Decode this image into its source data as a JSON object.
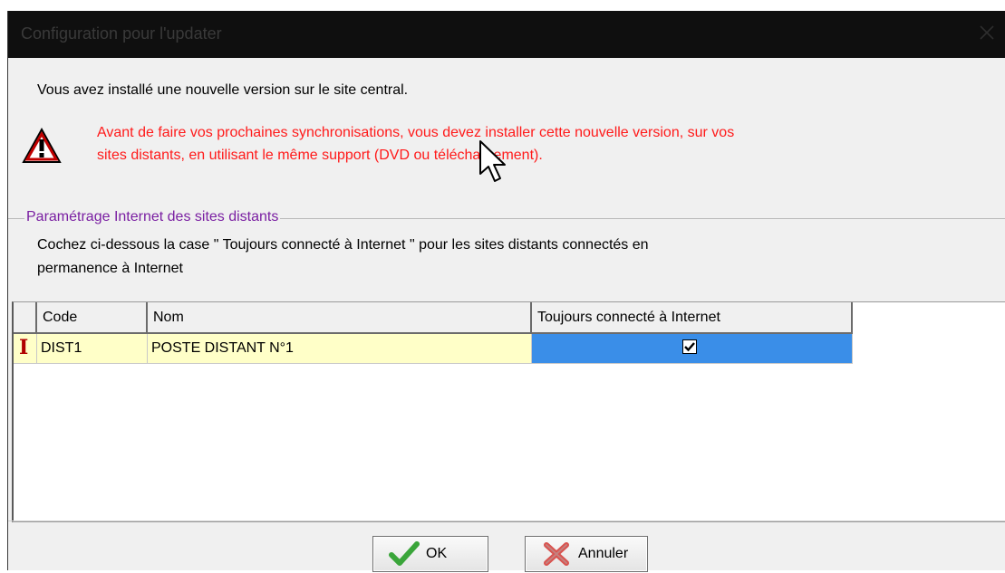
{
  "window": {
    "title": "Configuration pour l'updater",
    "close_icon": "close-icon"
  },
  "intro_text": "Vous avez installé une nouvelle version sur le site central.",
  "warning": {
    "icon": "warning-triangle-icon",
    "color": "#ff1a1a",
    "text_line1": "Avant de faire vos prochaines synchronisations, vous devez installer cette nouvelle version, sur vos",
    "text_line2": "sites distants, en utilisant le même support (DVD ou téléchargement)."
  },
  "group": {
    "title": "Paramétrage Internet des sites distants",
    "title_color": "#7a1fa2",
    "instruction_line1": "Cochez ci-dessous la case \" Toujours connecté à Internet \" pour les sites distants connectés en",
    "instruction_line2": "permanence à Internet"
  },
  "table": {
    "columns": [
      "Code",
      "Nom",
      "Toujours connecté à Internet"
    ],
    "rows": [
      {
        "indicator": "I",
        "code": "DIST1",
        "nom": "POSTE DISTANT N°1",
        "toujours_connecte": true
      }
    ],
    "row_color": "#ffffc8",
    "selected_color": "#3a8ee8"
  },
  "buttons": {
    "ok_label": "OK",
    "ok_icon": "checkmark-icon",
    "cancel_label": "Annuler",
    "cancel_icon": "cross-icon"
  }
}
